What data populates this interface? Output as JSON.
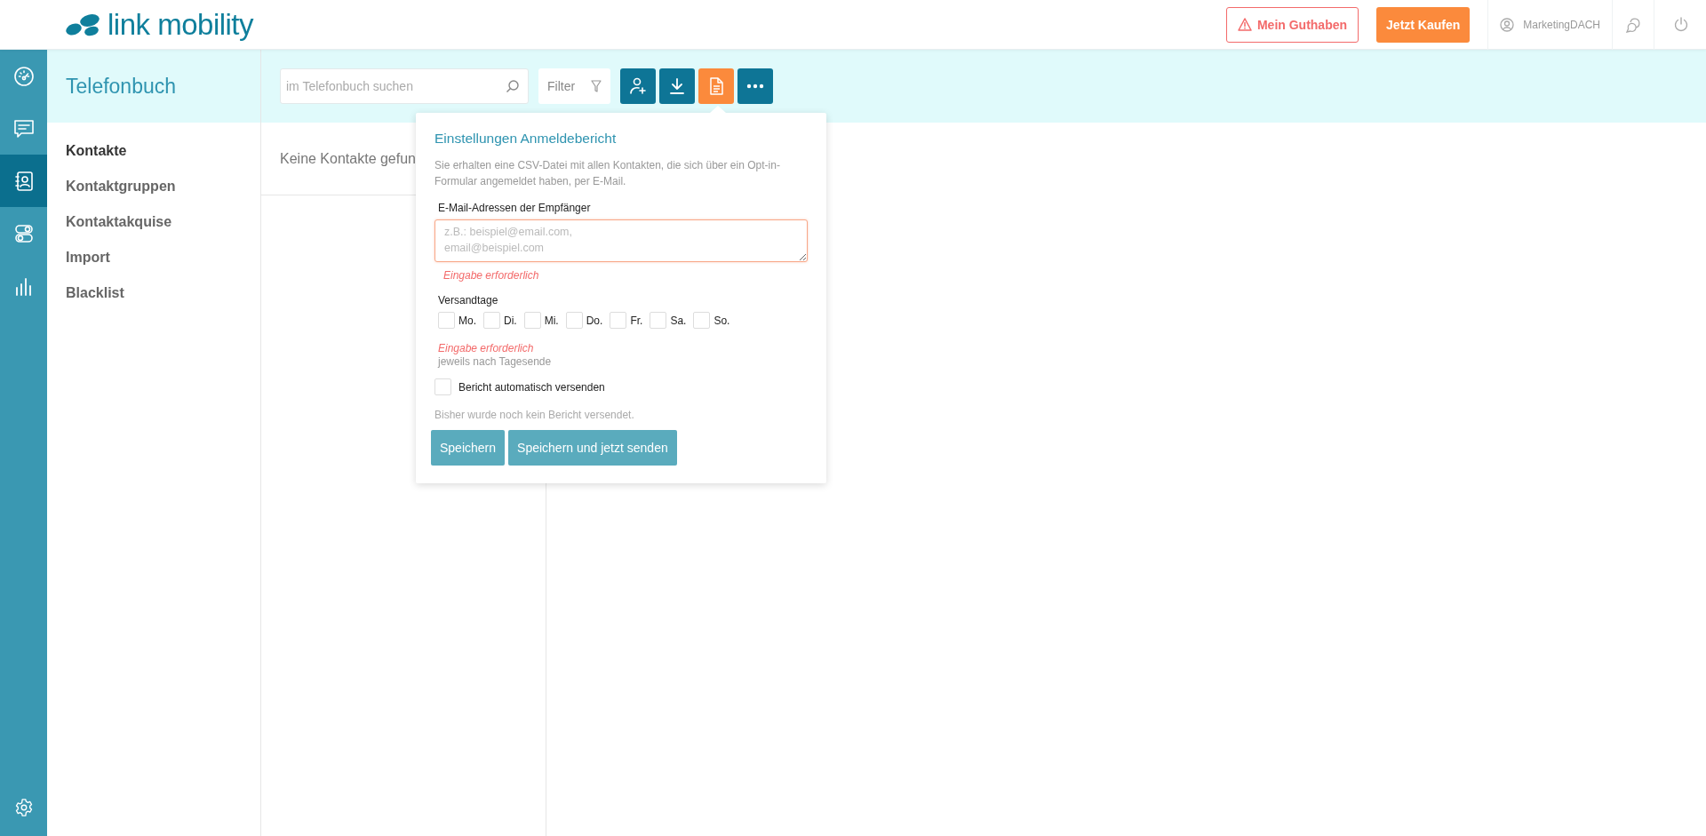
{
  "header": {
    "logo": "link mobility",
    "balance_button": "Mein Guthaben",
    "buy_button": "Jetzt Kaufen",
    "user": "MarketingDACH"
  },
  "rail": {
    "items": [
      {
        "kind": "dashboard",
        "selected": false
      },
      {
        "kind": "messages",
        "selected": false
      },
      {
        "kind": "contacts",
        "selected": true
      },
      {
        "kind": "toggles",
        "selected": false
      },
      {
        "kind": "statistics",
        "selected": false
      }
    ]
  },
  "section": {
    "title": "Telefonbuch",
    "items": [
      {
        "label": "Kontakte",
        "selected": true
      },
      {
        "label": "Kontaktgruppen",
        "selected": false
      },
      {
        "label": "Kontaktakquise",
        "selected": false
      },
      {
        "label": "Import",
        "selected": false
      },
      {
        "label": "Blacklist",
        "selected": false
      }
    ]
  },
  "toolbar": {
    "search": {
      "placeholder": "im Telefonbuch suchen"
    },
    "filter": "Filter",
    "actions": [
      {
        "kind": "add-contact",
        "selected": false
      },
      {
        "kind": "download",
        "selected": false
      },
      {
        "kind": "report",
        "selected": true
      },
      {
        "kind": "more",
        "selected": false
      }
    ]
  },
  "list": {
    "empty_text": "Keine Kontakte gefun"
  },
  "popup": {
    "title": "Einstellungen Anmeldebericht",
    "description": "Sie erhalten eine CSV-Datei mit allen Kontakten, die sich über ein Opt-in-Formular angemeldet haben, per E-Mail.",
    "email": {
      "label": "E-Mail-Adressen der Empfänger",
      "placeholder": "z.B.: beispiel@email.com,\nemail@beispiel.com",
      "invalid": true,
      "error": "Eingabe erforderlich"
    },
    "days": {
      "label": "Versandtage",
      "items": [
        {
          "label": "Mo.",
          "checked": false
        },
        {
          "label": "Di.",
          "checked": false
        },
        {
          "label": "Mi.",
          "checked": false
        },
        {
          "label": "Do.",
          "checked": false
        },
        {
          "label": "Fr.",
          "checked": false
        },
        {
          "label": "Sa.",
          "checked": false
        },
        {
          "label": "So.",
          "checked": false
        }
      ],
      "error": "Eingabe erforderlich",
      "hint": "jeweils nach Tagesende"
    },
    "auto_send": {
      "label": "Bericht automatisch versenden",
      "checked": false
    },
    "status": "Bisher wurde noch kein Bericht versendet.",
    "buttons": [
      "Speichern",
      "Speichern und jetzt senden"
    ]
  }
}
